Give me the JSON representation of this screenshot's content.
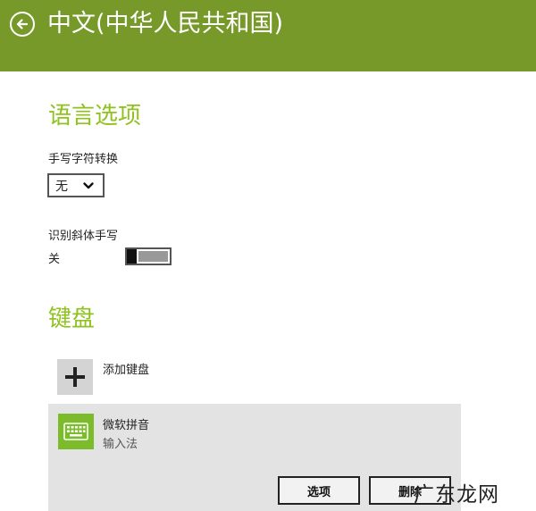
{
  "header": {
    "title": "中文(中华人民共和国)",
    "back_icon": "back-arrow-circle-icon"
  },
  "language_options": {
    "title": "语言选项",
    "handwriting": {
      "label": "手写字符转换",
      "selected": "无"
    },
    "italic": {
      "label": "识别斜体手写",
      "state_label": "关",
      "is_on": false
    }
  },
  "keyboard": {
    "title": "键盘",
    "add_label": "添加键盘",
    "items": [
      {
        "name": "微软拼音",
        "type": "输入法",
        "icon": "keyboard-icon"
      }
    ],
    "options_label": "选项",
    "delete_label": "删除"
  },
  "watermark": {
    "text": "广东龙网"
  },
  "colors": {
    "header_bg": "#76992a",
    "accent": "#8fc21f",
    "keyboard_icon_bg": "#7cbc2b",
    "panel_bg": "#e3e3e3"
  }
}
